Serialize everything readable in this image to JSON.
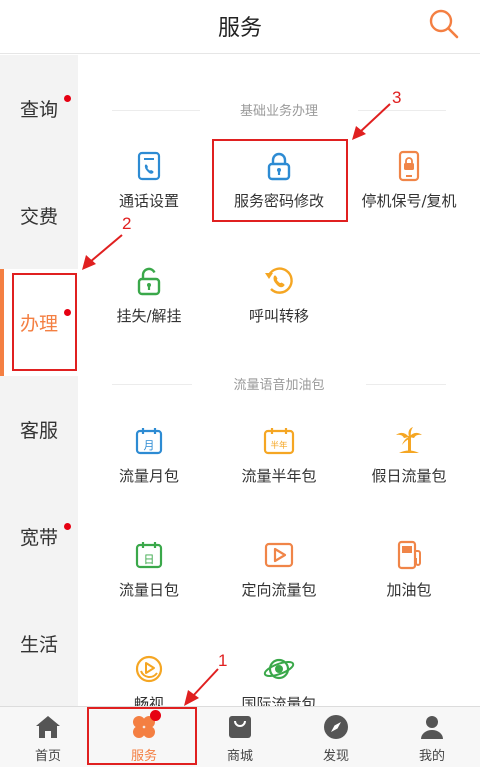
{
  "header": {
    "title": "服务",
    "search_icon": "search-icon"
  },
  "sidebar": {
    "items": [
      {
        "label": "查询",
        "has_dot": true
      },
      {
        "label": "交费",
        "has_dot": false
      },
      {
        "label": "办理",
        "has_dot": true,
        "active": true
      },
      {
        "label": "客服",
        "has_dot": false
      },
      {
        "label": "宽带",
        "has_dot": true
      },
      {
        "label": "生活",
        "has_dot": false
      }
    ]
  },
  "sections": [
    {
      "title": "基础业务办理",
      "tiles": [
        {
          "label": "通话设置",
          "icon": "phone-doc-icon",
          "color": "#2d8bd3"
        },
        {
          "label": "服务密码修改",
          "icon": "lock-icon",
          "color": "#2d8bd3"
        },
        {
          "label": "停机保号/复机",
          "icon": "phone-lock-icon",
          "color": "#f08548"
        },
        {
          "label": "挂失/解挂",
          "icon": "unlock-icon",
          "color": "#3aa84a"
        },
        {
          "label": "呼叫转移",
          "icon": "call-forward-icon",
          "color": "#f5a623"
        }
      ]
    },
    {
      "title": "流量语音加油包",
      "tiles": [
        {
          "label": "流量月包",
          "icon": "calendar-month-icon",
          "glyph": "月",
          "color": "#2d8bd3"
        },
        {
          "label": "流量半年包",
          "icon": "calendar-halfyear-icon",
          "glyph": "半年",
          "color": "#f5a623"
        },
        {
          "label": "假日流量包",
          "icon": "palm-tree-icon",
          "color": "#f5a623"
        },
        {
          "label": "流量日包",
          "icon": "calendar-day-icon",
          "glyph": "日",
          "color": "#3aa84a"
        },
        {
          "label": "定向流量包",
          "icon": "play-icon",
          "color": "#f08548"
        },
        {
          "label": "加油包",
          "icon": "fuel-icon",
          "color": "#f08548"
        },
        {
          "label": "畅视",
          "icon": "video-icon",
          "color": "#f5a623"
        },
        {
          "label": "国际流量包",
          "icon": "planet-icon",
          "color": "#3aa84a"
        }
      ]
    }
  ],
  "tabbar": {
    "items": [
      {
        "label": "首页",
        "icon": "home-icon"
      },
      {
        "label": "服务",
        "icon": "flower-icon",
        "active": true,
        "has_dot": true
      },
      {
        "label": "商城",
        "icon": "shopping-bag-icon"
      },
      {
        "label": "发现",
        "icon": "compass-icon"
      },
      {
        "label": "我的",
        "icon": "user-icon"
      }
    ]
  },
  "annotations": {
    "step1": "1",
    "step2": "2",
    "step3": "3"
  },
  "colors": {
    "accent": "#f47f42",
    "dot": "#e60012",
    "annotation": "#e02020",
    "blue": "#2d8bd3",
    "green": "#3aa84a",
    "yellow": "#f5a623",
    "orange": "#f08548"
  }
}
